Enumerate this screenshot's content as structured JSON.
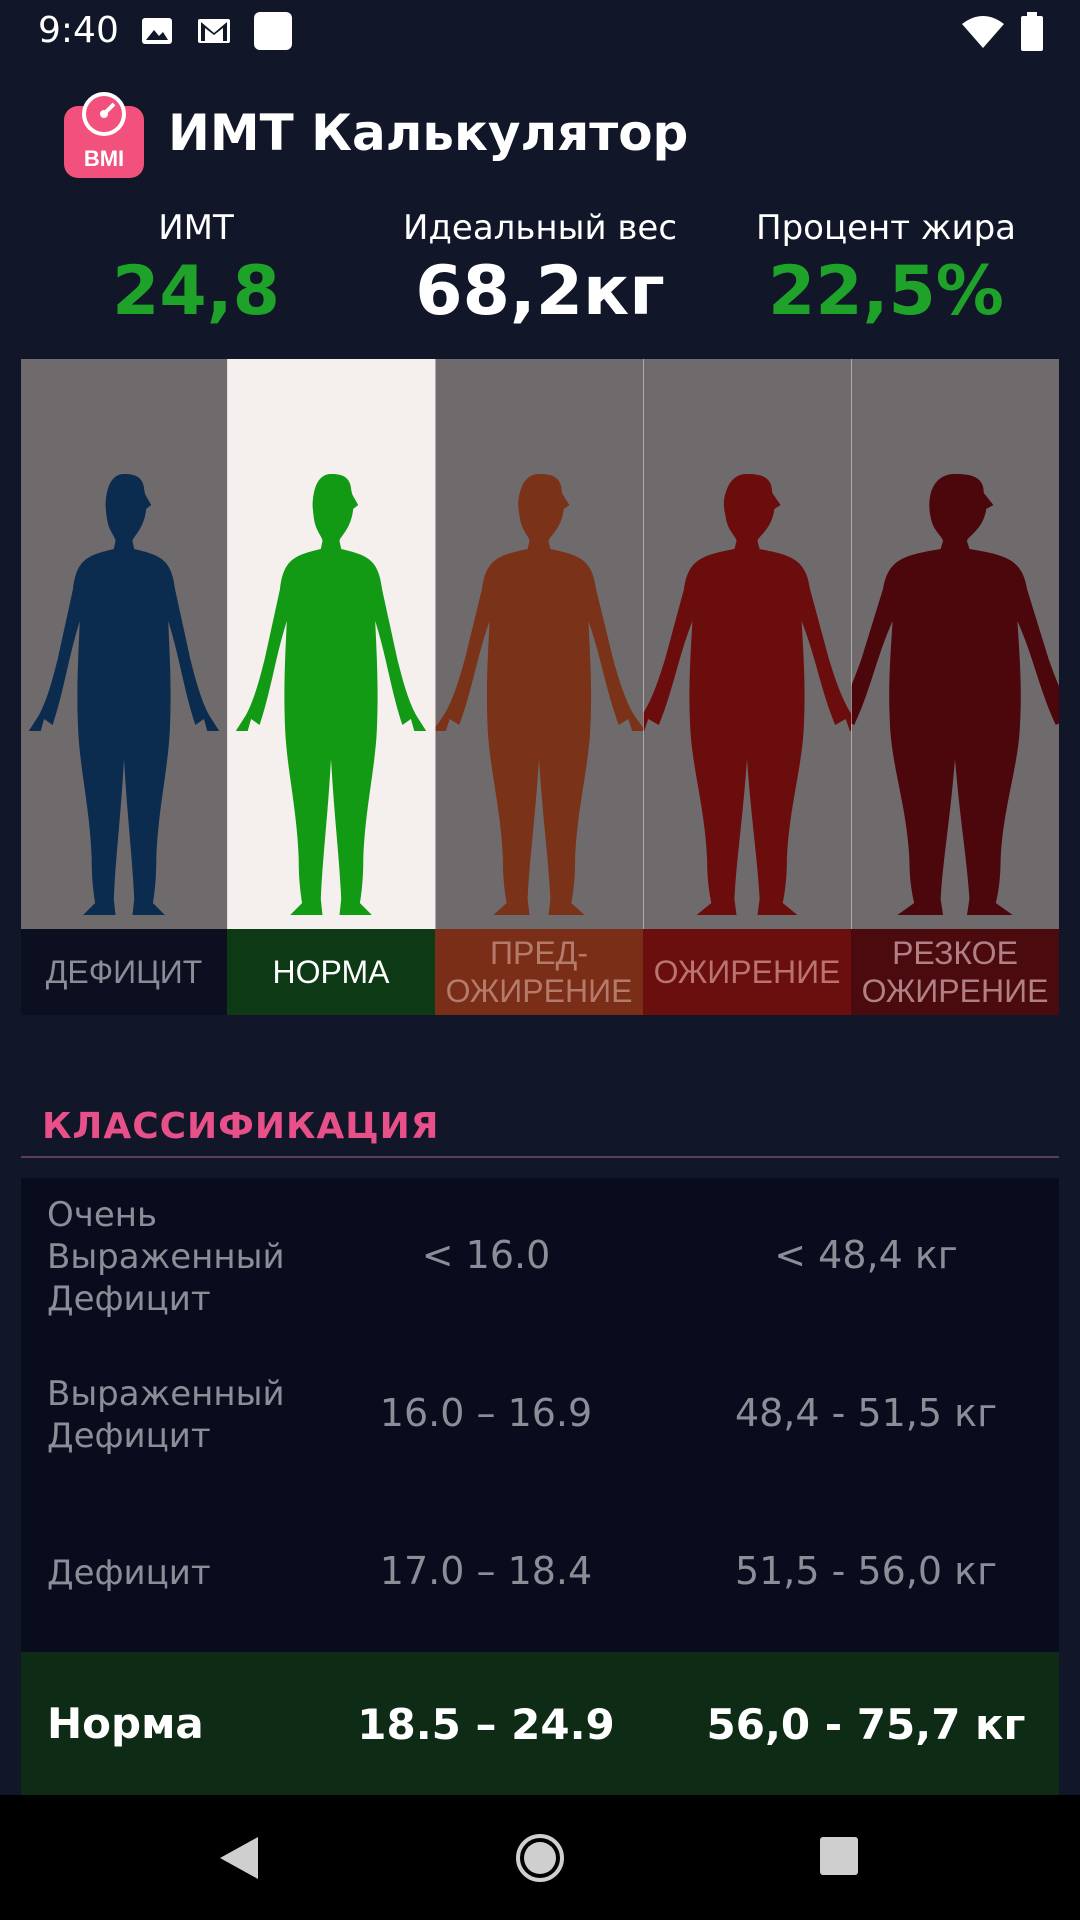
{
  "status_bar": {
    "time": "9:40"
  },
  "app": {
    "title": "ИМТ Калькулятор",
    "icon_text": "BMI"
  },
  "stats": [
    {
      "label": "ИМТ",
      "value": "24,8",
      "color": "#1fa22a"
    },
    {
      "label": "Идеальный вес",
      "value": "68,2кг",
      "color": "#ffffff"
    },
    {
      "label": "Процент жира",
      "value": "22,5%",
      "color": "#1fa22a"
    }
  ],
  "categories": [
    {
      "label": "ДЕФИЦИТ",
      "bg": "#0c0f1f",
      "text": "#8a8d96",
      "figure": "#0c2c4f",
      "panel": "#6f6b6d"
    },
    {
      "label": "НОРМА",
      "bg": "#0d3a15",
      "text": "#ffffff",
      "figure": "#139a15",
      "panel": "#f5f0ee",
      "active": true
    },
    {
      "label": "ПРЕД-\nОЖИРЕНИЕ",
      "bg": "#7a2e17",
      "text": "#b47a6a",
      "figure": "#7a3218",
      "panel": "#6f6b6d"
    },
    {
      "label": "ОЖИРЕНИЕ",
      "bg": "#6b0e0e",
      "text": "#b97373",
      "figure": "#6c0d0d",
      "panel": "#6f6b6d"
    },
    {
      "label": "РЕЗКОЕ\nОЖИРЕНИЕ",
      "bg": "#4b0a0e",
      "text": "#b08084",
      "figure": "#4b070c",
      "panel": "#6f6b6d"
    }
  ],
  "classification": {
    "title": "КЛАССИФИКАЦИЯ",
    "rows": [
      {
        "name": "Очень\nВыраженный\nДефицит",
        "bmi": "< 16.0",
        "weight": "< 48,4 кг"
      },
      {
        "name": "Выраженный\nДефицит",
        "bmi": "16.0 – 16.9",
        "weight": "48,4 - 51,5 кг"
      },
      {
        "name": "Дефицит",
        "bmi": "17.0 – 18.4",
        "weight": "51,5 - 56,0 кг"
      },
      {
        "name": "Норма",
        "bmi": "18.5 – 24.9",
        "weight": "56,0 - 75,7 кг",
        "highlight": true
      }
    ]
  }
}
